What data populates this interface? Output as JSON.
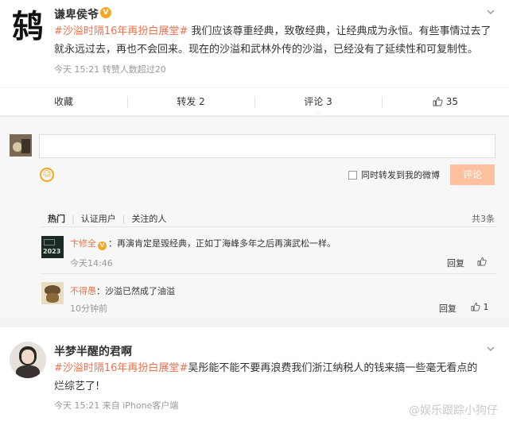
{
  "post1": {
    "author": "谦卑侯爷",
    "topic": "#沙溢时隔16年再扮白展堂#",
    "text": " 我们应该尊重经典，致敬经典，让经典成为永恒。有些事情过去了就永远过去，再也不会回来。现在的沙溢和武林外传的沙溢，已经没有了延续性和可复制性。",
    "meta": "今天 15:21 转赞人数超过20",
    "actions": {
      "collect": "收藏",
      "forward": "转发 2",
      "comment": "评论 3",
      "like": "35"
    }
  },
  "reply": {
    "forward_label": "同时转发到我的微博",
    "submit": "评论",
    "tabs": [
      "热门",
      "认证用户",
      "关注的人"
    ],
    "total": "共3条"
  },
  "comments": [
    {
      "name": "卞修全",
      "text": "：再演肯定是毁经典，正如丁海峰多年之后再演武松一样。",
      "time": "今天14:46",
      "reply": "回复",
      "like": "",
      "avatar_text": "2023"
    },
    {
      "name": "不得愚",
      "text": "：沙溢已然成了油溢",
      "time": "10分钟前",
      "reply": "回复",
      "like": "1"
    }
  ],
  "post2": {
    "author": "半梦半醒的君啊",
    "topic": "#沙溢时隔16年再扮白展堂#",
    "text": "吴彤能不能不要再浪费我们浙江纳税人的钱来搞一些毫无看点的烂综艺了!",
    "meta": "今天 15:21 来自 iPhone客户端"
  },
  "watermark": "@娱乐跟踪小狗仔",
  "colors": {
    "accent": "#eb7350",
    "vip_badge": "#f5a623",
    "button_disabled": "#ffc09f"
  },
  "icons": [
    "chevron-down-icon",
    "thumbs-up-icon",
    "smiley-icon",
    "verified-badge-icon"
  ]
}
